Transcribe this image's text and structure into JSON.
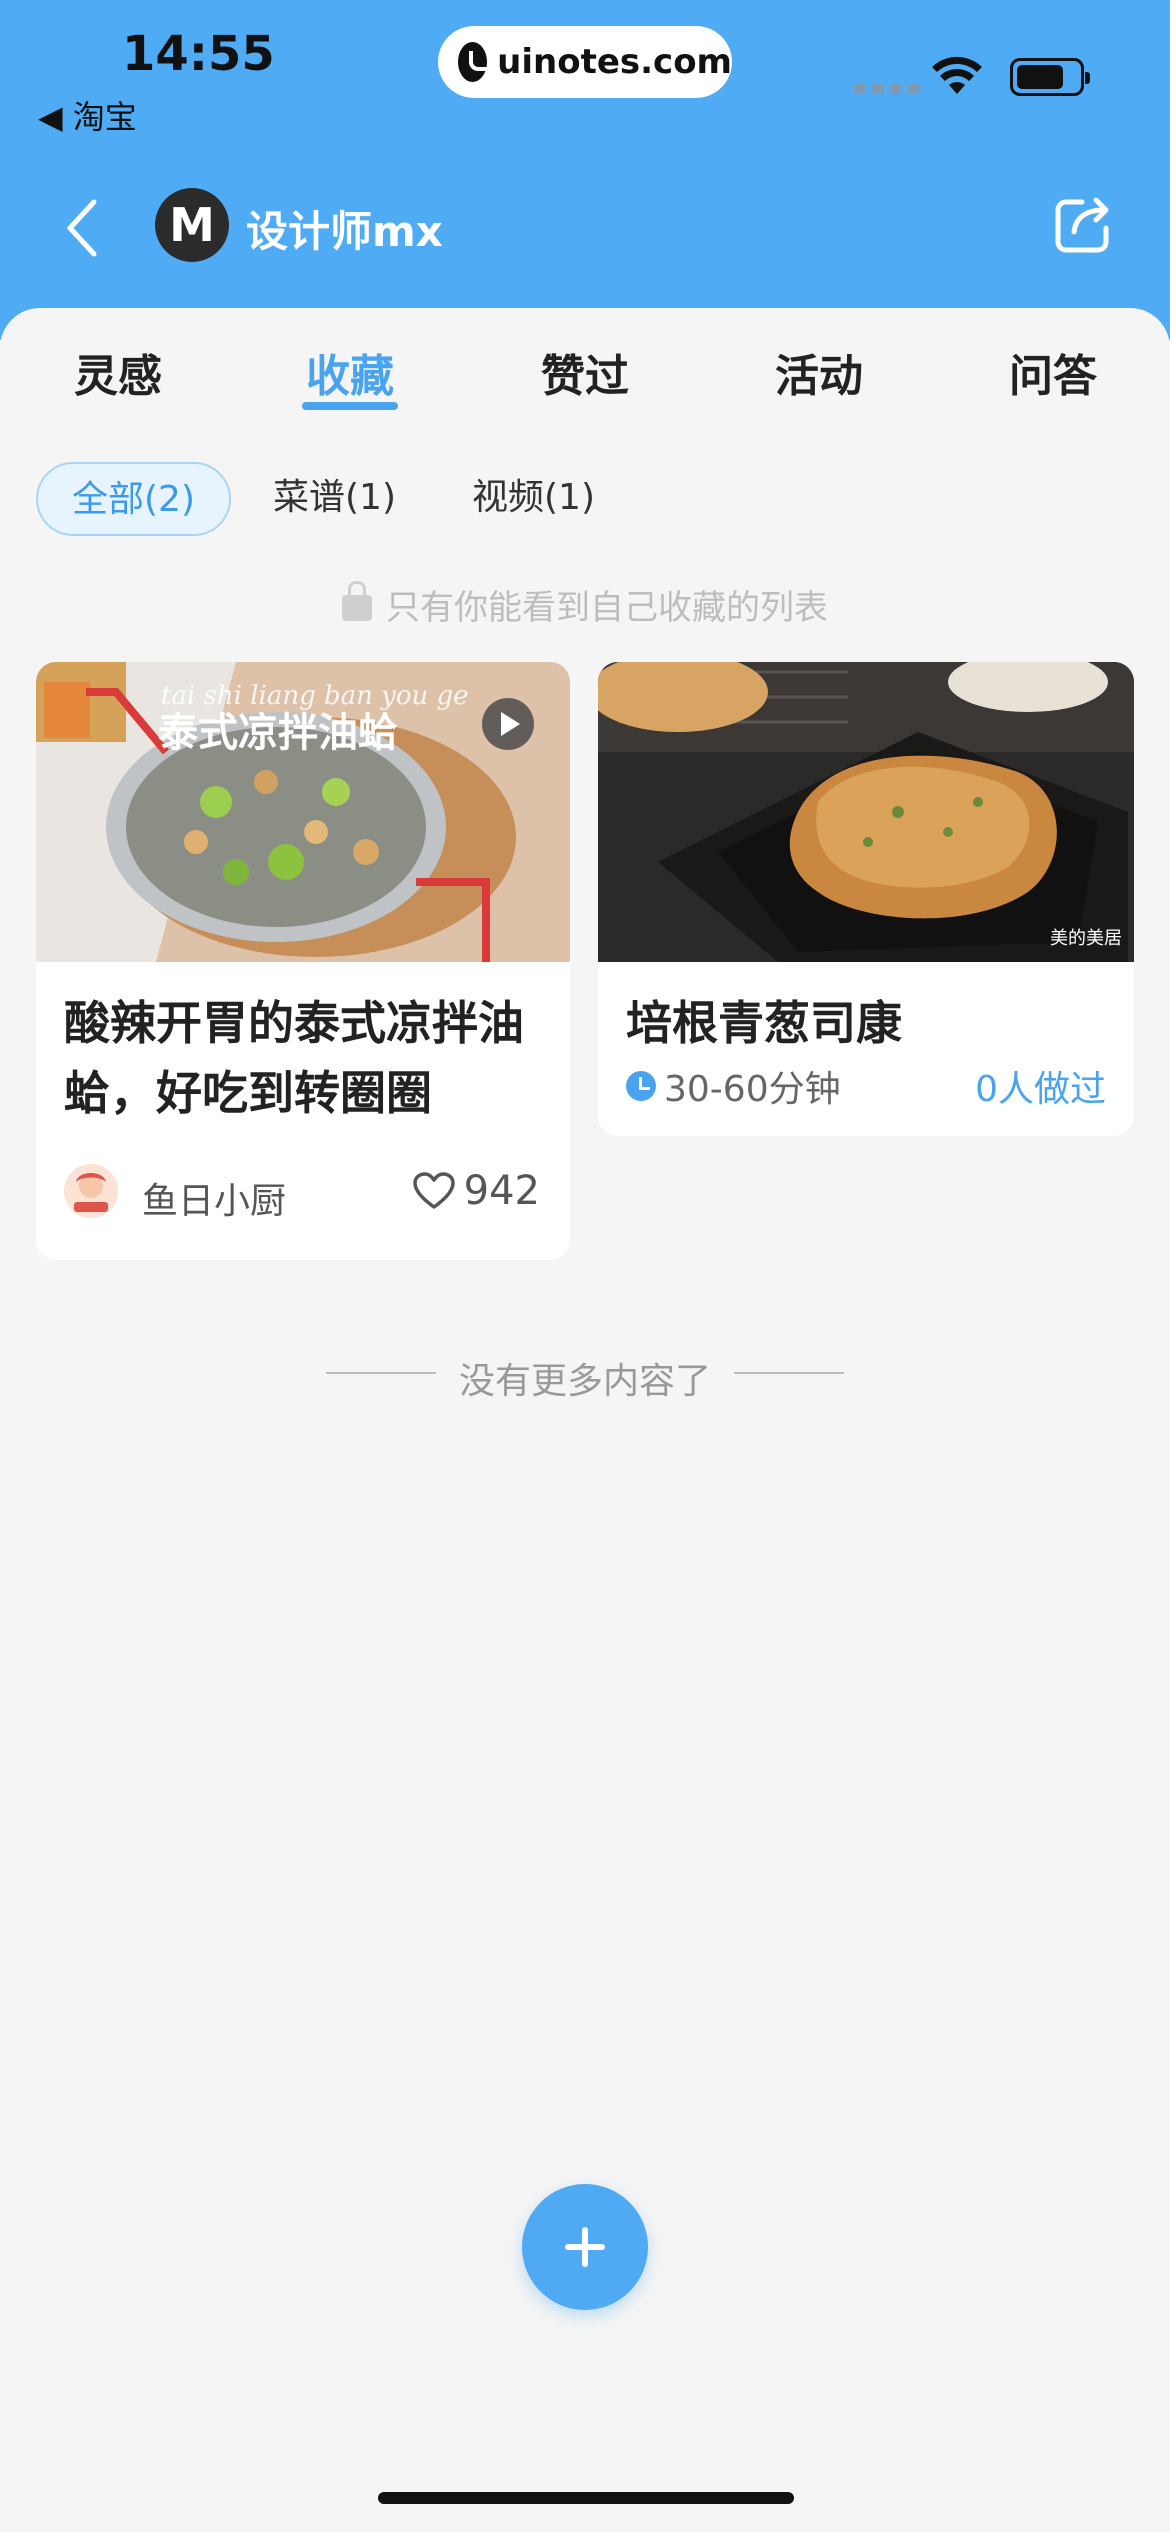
{
  "status_bar": {
    "time": "14:55",
    "back_app": "◀ 淘宝",
    "url": "uinotes.com"
  },
  "profile": {
    "avatar_letter": "M",
    "name": "设计师mx"
  },
  "tabs": [
    {
      "label": "灵感"
    },
    {
      "label": "收藏"
    },
    {
      "label": "赞过"
    },
    {
      "label": "活动"
    },
    {
      "label": "问答"
    }
  ],
  "active_tab": "收藏",
  "filters": [
    {
      "label": "全部(2)"
    },
    {
      "label": "菜谱(1)"
    },
    {
      "label": "视频(1)"
    }
  ],
  "privacy_note": "只有你能看到自己收藏的列表",
  "cards": [
    {
      "title": "酸辣开胃的泰式凉拌油蛤，好吃到转圈圈",
      "image_overlay_title": "泰式凉拌油蛤",
      "image_overlay_subtitle": "tai shi liang ban you ge",
      "author": "鱼日小厨",
      "likes": "942"
    },
    {
      "title": "培根青葱司康",
      "time": "30-60分钟",
      "made_count": "0人做过",
      "image_watermark": "美的美居"
    }
  ],
  "no_more": "没有更多内容了",
  "colors": {
    "header": "#4facf4",
    "accent": "#4aa3ee",
    "background": "#f5f5f5"
  }
}
